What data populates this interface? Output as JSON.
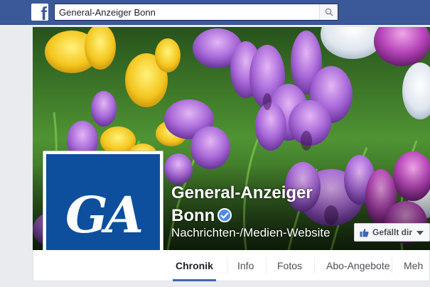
{
  "search": {
    "value": "General-Anzeiger Bonn"
  },
  "page": {
    "name_line1": "General-Anzeiger",
    "name_line2": "Bonn",
    "category": "Nachrichten-/Medien-Website",
    "logo_text": "GA"
  },
  "like_button": {
    "label": "Gefällt dir"
  },
  "tabs": [
    {
      "label": "Chronik"
    },
    {
      "label": "Info"
    },
    {
      "label": "Fotos"
    },
    {
      "label": "Abo-Angebote"
    },
    {
      "label": "Meh"
    }
  ],
  "colors": {
    "brand_blue": "#3b5998",
    "logo_blue": "#0d4f9c",
    "verified_blue": "#4b8af0"
  }
}
